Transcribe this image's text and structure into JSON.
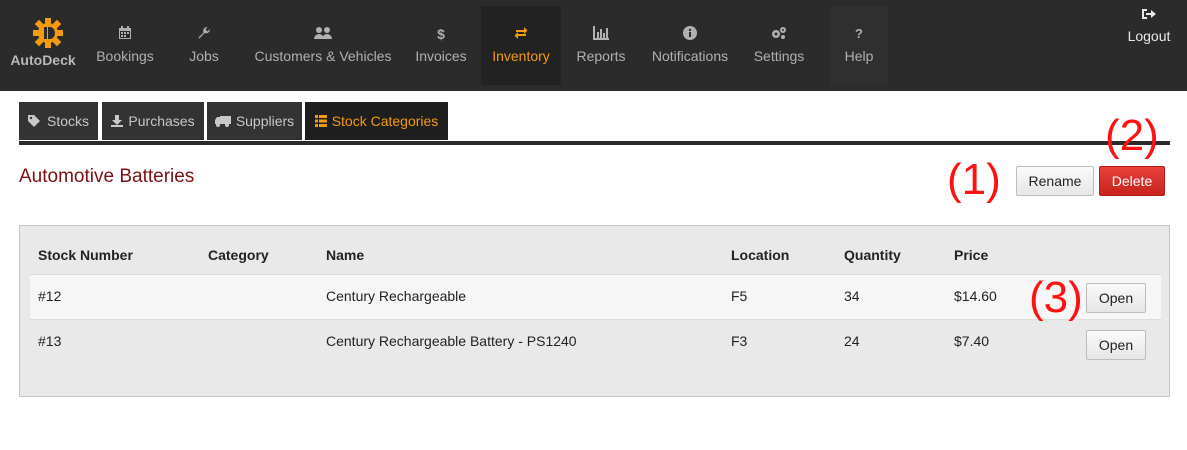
{
  "app": {
    "brand": "AutoDeck"
  },
  "nav": {
    "items": [
      {
        "label": "Bookings",
        "icon": "calendar-icon"
      },
      {
        "label": "Jobs",
        "icon": "wrench-icon"
      },
      {
        "label": "Customers & Vehicles",
        "icon": "users-icon"
      },
      {
        "label": "Invoices",
        "icon": "dollar-icon"
      },
      {
        "label": "Inventory",
        "icon": "exchange-icon"
      },
      {
        "label": "Reports",
        "icon": "bar-chart-icon"
      },
      {
        "label": "Notifications",
        "icon": "info-icon"
      },
      {
        "label": "Settings",
        "icon": "cogs-icon"
      },
      {
        "label": "Help",
        "icon": "question-icon"
      }
    ],
    "active": "Inventory",
    "logout": "Logout"
  },
  "tabs": [
    {
      "label": "Stocks",
      "icon": "tags-icon"
    },
    {
      "label": "Purchases",
      "icon": "download-icon"
    },
    {
      "label": "Suppliers",
      "icon": "truck-icon"
    },
    {
      "label": "Stock Categories",
      "icon": "list-icon"
    }
  ],
  "page": {
    "title": "Automotive Batteries",
    "rename_label": "Rename",
    "delete_label": "Delete"
  },
  "annotations": [
    "(1)",
    "(2)",
    "(3)"
  ],
  "table": {
    "columns": [
      "Stock Number",
      "Category",
      "Name",
      "Location",
      "Quantity",
      "Price"
    ],
    "rows": [
      {
        "stock_number": "#12",
        "category": "",
        "name": "Century Rechargeable",
        "location": "F5",
        "quantity": "34",
        "price": "$14.60",
        "action": "Open"
      },
      {
        "stock_number": "#13",
        "category": "",
        "name": "Century Rechargeable Battery - PS1240",
        "location": "F3",
        "quantity": "24",
        "price": "$7.40",
        "action": "Open"
      }
    ]
  },
  "colors": {
    "accent": "#f39c12",
    "title": "#7a1010",
    "danger": "#d9302a",
    "annotation": "#ff1111"
  }
}
